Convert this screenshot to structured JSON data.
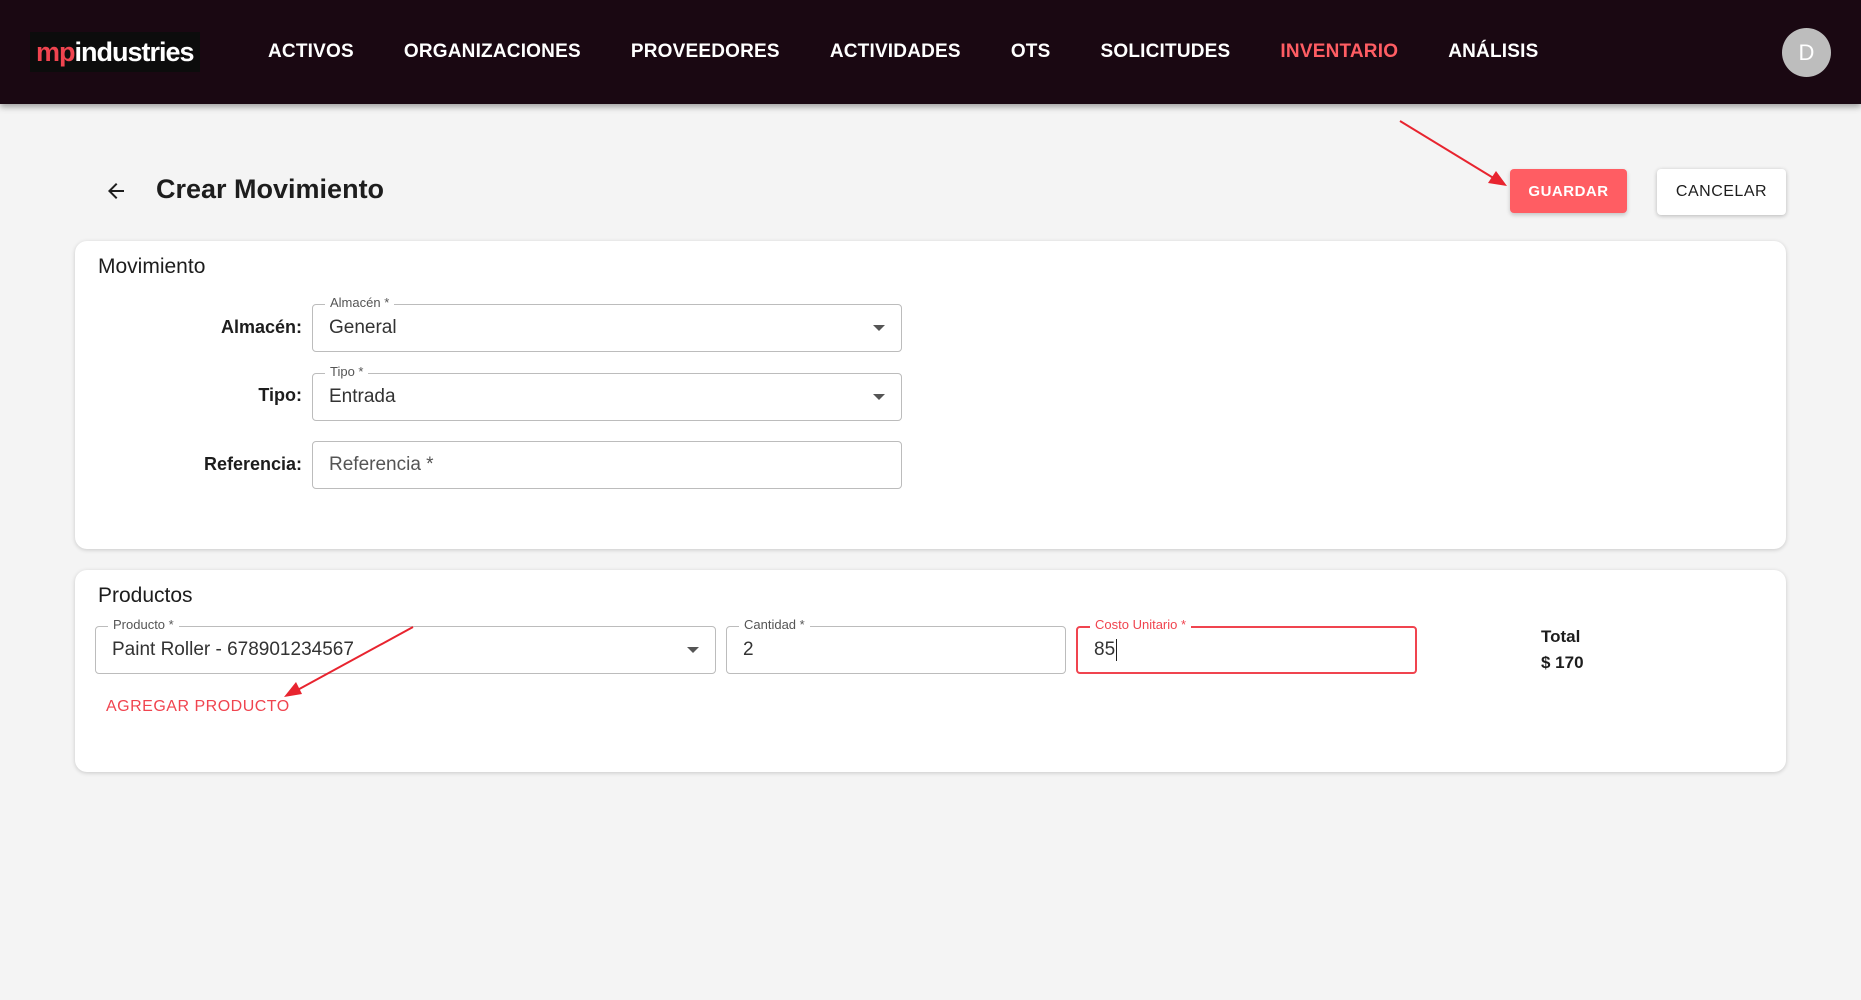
{
  "brand": {
    "logo_left": "mp",
    "logo_right": "industries"
  },
  "nav": {
    "items": [
      {
        "label": "ACTIVOS"
      },
      {
        "label": "ORGANIZACIONES"
      },
      {
        "label": "PROVEEDORES"
      },
      {
        "label": "ACTIVIDADES"
      },
      {
        "label": "OTS"
      },
      {
        "label": "SOLICITUDES"
      },
      {
        "label": "INVENTARIO",
        "active": true
      },
      {
        "label": "ANÁLISIS"
      }
    ]
  },
  "user": {
    "avatar_initial": "D"
  },
  "header": {
    "title": "Crear Movimiento",
    "save_label": "GUARDAR",
    "cancel_label": "CANCELAR"
  },
  "movimiento": {
    "title": "Movimiento",
    "almacen": {
      "label": "Almacén:",
      "legend": "Almacén *",
      "value": "General"
    },
    "tipo": {
      "label": "Tipo:",
      "legend": "Tipo *",
      "value": "Entrada"
    },
    "referencia": {
      "label": "Referencia:",
      "placeholder": "Referencia *"
    }
  },
  "productos": {
    "title": "Productos",
    "producto": {
      "legend": "Producto *",
      "value": "Paint Roller - 678901234567"
    },
    "cantidad": {
      "legend": "Cantidad *",
      "value": "2"
    },
    "costo": {
      "legend": "Costo Unitario *",
      "value": "85"
    },
    "total_label": "Total",
    "total_value": "$ 170",
    "add_label": "AGREGAR PRODUCTO"
  },
  "colors": {
    "accent": "#ff5d63",
    "topbar": "#1a0812",
    "annotation": "#e8242f"
  },
  "icons": [
    "back-arrow-icon",
    "chevron-down-icon",
    "annotation-arrow"
  ]
}
